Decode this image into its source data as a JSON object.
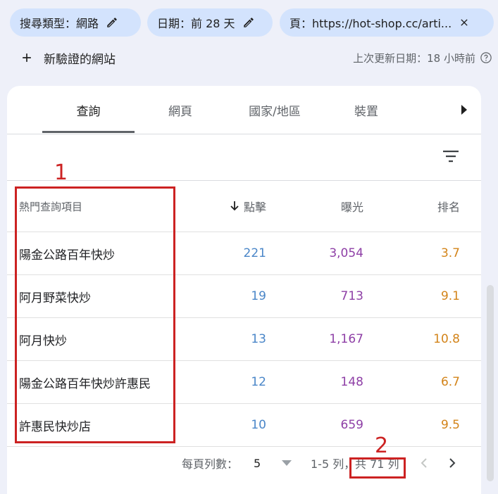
{
  "filters": {
    "search_type": "搜尋類型：網路",
    "date": "日期：前 28 天",
    "page": "頁：https://hot-shop.cc/arti..."
  },
  "top_bar": {
    "add_site_label": "新驗證的網站",
    "updated_text": "上次更新日期：18 小時前"
  },
  "tabs": [
    {
      "label": "查詢",
      "active": true
    },
    {
      "label": "網頁",
      "active": false
    },
    {
      "label": "國家/地區",
      "active": false
    },
    {
      "label": "裝置",
      "active": false
    }
  ],
  "table": {
    "headers": {
      "query": "熱門查詢項目",
      "clicks": "點擊",
      "impressions": "曝光",
      "position": "排名"
    },
    "rows": [
      {
        "query": "陽金公路百年快炒",
        "clicks": "221",
        "impressions": "3,054",
        "position": "3.7"
      },
      {
        "query": "阿月野菜快炒",
        "clicks": "19",
        "impressions": "713",
        "position": "9.1"
      },
      {
        "query": "阿月快炒",
        "clicks": "13",
        "impressions": "1,167",
        "position": "10.8"
      },
      {
        "query": "陽金公路百年快炒許惠民",
        "clicks": "12",
        "impressions": "148",
        "position": "6.7"
      },
      {
        "query": "許惠民快炒店",
        "clicks": "10",
        "impressions": "659",
        "position": "9.5"
      }
    ]
  },
  "pagination": {
    "rows_per_page_label": "每頁列數：",
    "rows_per_page_value": "5",
    "range_text": "1-5 列，",
    "total_text": "共 71 列"
  },
  "annotations": {
    "box1_number": "1",
    "box2_number": "2"
  },
  "colors": {
    "clicks": "#4a86c8",
    "impressions": "#8e3fa6",
    "position": "#d3841a",
    "annotation_red": "#cc2222"
  }
}
